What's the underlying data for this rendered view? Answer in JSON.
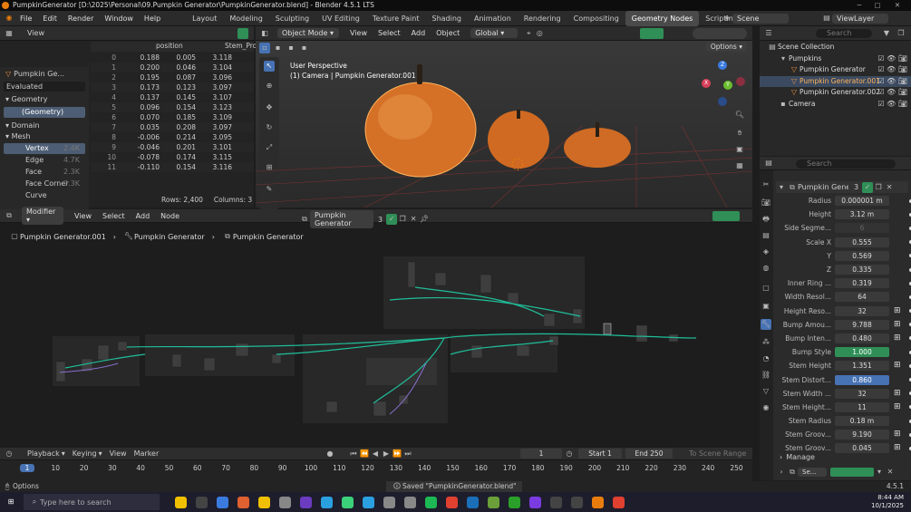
{
  "titlebar": {
    "title": "PumpkinGenerator [D:\\2025\\Personal\\09.Pumpkin Generator\\PumpkinGenerator.blend] - Blender 4.5.1 LTS"
  },
  "menus": [
    "File",
    "Edit",
    "Render",
    "Window",
    "Help"
  ],
  "workspaces": [
    "Layout",
    "Modeling",
    "Sculpting",
    "UV Editing",
    "Texture Paint",
    "Shading",
    "Animation",
    "Rendering",
    "Compositing",
    "Geometry Nodes",
    "Scripting"
  ],
  "active_workspace": "Geometry Nodes",
  "scene": {
    "label": "Scene",
    "view_layer": "ViewLayer"
  },
  "spreadsheet": {
    "view_label": "View",
    "object": "Pumpkin Ge...",
    "evaluated": "Evaluated",
    "geometry_label": "Geometry",
    "geometry_item": "(Geometry)",
    "domain_label": "Domain",
    "mesh_label": "Mesh",
    "domains": [
      {
        "name": "Vertex",
        "count": "2.4K"
      },
      {
        "name": "Edge",
        "count": "4.7K"
      },
      {
        "name": "Face",
        "count": "2.3K"
      },
      {
        "name": "Face Corner",
        "count": "9.3K"
      },
      {
        "name": "Curve",
        "count": ""
      }
    ],
    "col_position": "position",
    "col_stem": "Stem_Pro",
    "rows": [
      [
        "0",
        "0.188",
        "0.005",
        "3.118"
      ],
      [
        "1",
        "0.200",
        "0.046",
        "3.104"
      ],
      [
        "2",
        "0.195",
        "0.087",
        "3.096"
      ],
      [
        "3",
        "0.173",
        "0.123",
        "3.097"
      ],
      [
        "4",
        "0.137",
        "0.145",
        "3.107"
      ],
      [
        "5",
        "0.096",
        "0.154",
        "3.123"
      ],
      [
        "6",
        "0.070",
        "0.185",
        "3.109"
      ],
      [
        "7",
        "0.035",
        "0.208",
        "3.097"
      ],
      [
        "8",
        "-0.006",
        "0.214",
        "3.095"
      ],
      [
        "9",
        "-0.046",
        "0.201",
        "3.101"
      ],
      [
        "10",
        "-0.078",
        "0.174",
        "3.115"
      ],
      [
        "11",
        "-0.110",
        "0.154",
        "3.116"
      ]
    ],
    "rows_label": "Rows: 2,400",
    "columns_label": "Columns: 3"
  },
  "viewport": {
    "mode": "Object Mode",
    "menus": [
      "View",
      "Select",
      "Add",
      "Object"
    ],
    "transform": "Global",
    "options": "Options",
    "perspective": "User Perspective",
    "camera_line": "(1) Camera | Pumpkin Generator.001"
  },
  "node_editor": {
    "editor": "Modifier",
    "menus": [
      "View",
      "Select",
      "Add",
      "Node"
    ],
    "tree_name": "Pumpkin Generator",
    "users": "3",
    "breadcrumb": [
      "Pumpkin Generator.001",
      "Pumpkin Generator",
      "Pumpkin Generator"
    ]
  },
  "timeline": {
    "playback": "Playback",
    "keying": "Keying",
    "view": "View",
    "marker": "Marker",
    "current": "1",
    "start_label": "Start",
    "start": "1",
    "end_label": "End",
    "end": "250",
    "to_scene": "To Scene Range",
    "ticks": [
      "1",
      "10",
      "20",
      "30",
      "40",
      "50",
      "60",
      "70",
      "80",
      "90",
      "100",
      "110",
      "120",
      "130",
      "140",
      "150",
      "160",
      "170",
      "180",
      "190",
      "200",
      "210",
      "220",
      "230",
      "240",
      "250"
    ]
  },
  "outliner": {
    "search_placeholder": "Search",
    "items": [
      {
        "name": "Scene Collection",
        "indent": 0,
        "sel": false
      },
      {
        "name": "Pumpkins",
        "indent": 1,
        "sel": false
      },
      {
        "name": "Pumpkin Generator",
        "indent": 2,
        "sel": false
      },
      {
        "name": "Pumpkin Generator.001",
        "indent": 2,
        "sel": true
      },
      {
        "name": "Pumpkin Generator.002",
        "indent": 2,
        "sel": false
      },
      {
        "name": "Camera",
        "indent": 1,
        "sel": false
      }
    ]
  },
  "properties": {
    "search_placeholder": "Search",
    "modifier_name": "Pumpkin Gener...",
    "users": "3",
    "manage": "Manage",
    "object_short": "Se...",
    "fields": [
      {
        "label": "Radius",
        "value": "0.000001 m",
        "style": "normal"
      },
      {
        "label": "Height",
        "value": "3.12 m",
        "style": "normal"
      },
      {
        "label": "Side Segme...",
        "value": "6",
        "style": "gray"
      },
      {
        "label": "Scale X",
        "value": "0.555",
        "style": "normal"
      },
      {
        "label": "Y",
        "value": "0.569",
        "style": "normal"
      },
      {
        "label": "Z",
        "value": "0.335",
        "style": "normal"
      },
      {
        "label": "Inner Ring ...",
        "value": "0.319",
        "style": "normal"
      },
      {
        "label": "Width Resol...",
        "value": "64",
        "style": "normal"
      },
      {
        "label": "Height Reso...",
        "value": "32",
        "style": "normal"
      },
      {
        "label": "Bump Amou...",
        "value": "9.788",
        "style": "normal"
      },
      {
        "label": "Bump Inten...",
        "value": "0.480",
        "style": "normal"
      },
      {
        "label": "Bump Style",
        "value": "1.000",
        "style": "green"
      },
      {
        "label": "Stem Height",
        "value": "1.351",
        "style": "normal"
      },
      {
        "label": "Stem Distort...",
        "value": "0.860",
        "style": "blue"
      },
      {
        "label": "Stem Width ...",
        "value": "32",
        "style": "normal"
      },
      {
        "label": "Stem Height...",
        "value": "11",
        "style": "normal"
      },
      {
        "label": "Stem Radius",
        "value": "0.18 m",
        "style": "normal"
      },
      {
        "label": "Stem Groov...",
        "value": "9.190",
        "style": "normal"
      },
      {
        "label": "Stem Groov...",
        "value": "0.045",
        "style": "normal"
      }
    ]
  },
  "status": {
    "options": "Options",
    "saved": "Saved \"PumpkinGenerator.blend\"",
    "version": "4.5.1"
  },
  "taskbar": {
    "search_placeholder": "Type here to search",
    "time": "8:44 AM",
    "date": "10/1/2025"
  },
  "colors": {
    "accent": "#4772b3",
    "node_link": "#1fbf9a",
    "pumpkin": "#e07a2a",
    "selected_outline": "#ffb35c"
  }
}
